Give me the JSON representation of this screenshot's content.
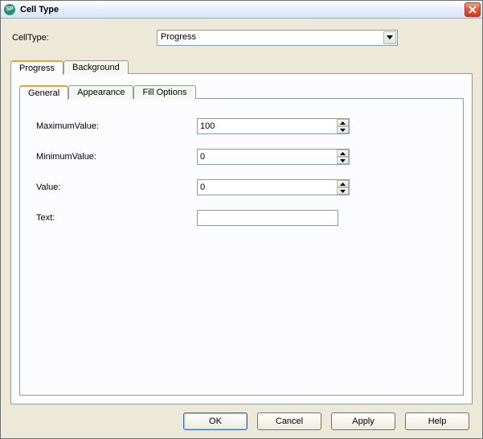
{
  "window": {
    "title": "Cell Type",
    "icon_text": "SP"
  },
  "cellType": {
    "label": "CellType:",
    "value": "Progress"
  },
  "outerTabs": {
    "t0": "Progress",
    "t1": "Background"
  },
  "innerTabs": {
    "t0": "General",
    "t1": "Appearance",
    "t2": "Fill Options"
  },
  "form": {
    "maxValue": {
      "label": "MaximumValue:",
      "value": "100"
    },
    "minValue": {
      "label": "MinimumValue:",
      "value": "0"
    },
    "value": {
      "label": "Value:",
      "value": "0"
    },
    "text": {
      "label": "Text:",
      "value": ""
    }
  },
  "buttons": {
    "ok": "OK",
    "cancel": "Cancel",
    "apply": "Apply",
    "help": "Help"
  }
}
